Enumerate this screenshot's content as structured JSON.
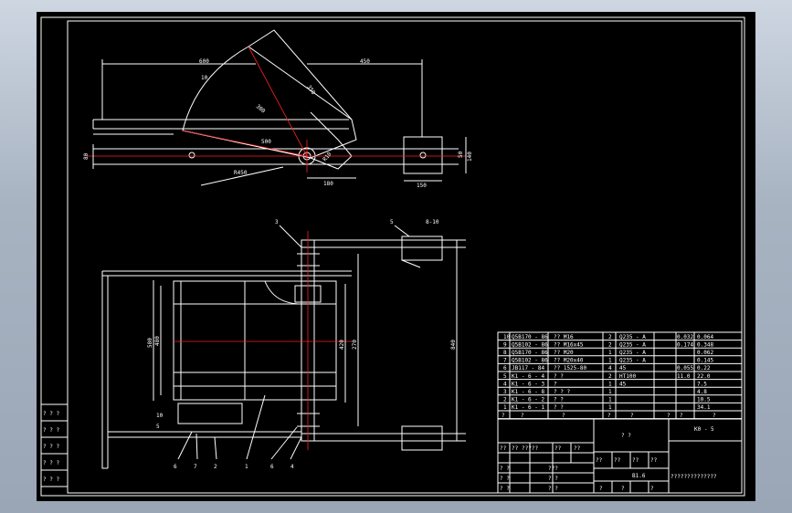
{
  "dims": {
    "d600": "600",
    "d450": "450",
    "d300": "300",
    "d350": "350",
    "d10": "10",
    "d500": "500",
    "d80": "80",
    "d140": "140",
    "d50": "50",
    "dR450": "R450",
    "dR10": "R10",
    "d180": "180",
    "d150": "150",
    "d8_10": "8-10",
    "d580": "580",
    "d480": "480",
    "d420": "420",
    "d270": "270",
    "d840": "840",
    "d10b": "10",
    "d5": "5"
  },
  "balloons": {
    "b3": "3",
    "b5": "5",
    "b6": "6",
    "b7": "7",
    "b2": "2",
    "b1": "1",
    "b6b": "6",
    "b4": "4"
  },
  "bom": [
    [
      "10",
      "Q5B170 - 86",
      "?? M16",
      "2",
      "Q235 - A",
      "0.032",
      "0.064"
    ],
    [
      "9",
      "Q5B102 - 86",
      "?? M16x45",
      "2",
      "Q235 - A",
      "0.174",
      "0.348"
    ],
    [
      "8",
      "Q5B170 - 86",
      "?? M20",
      "1",
      "Q235 - A",
      "",
      "0.062"
    ],
    [
      "7",
      "Q5B102 - 86",
      "?? M20x40",
      "1",
      "Q235 - A",
      "",
      "0.145"
    ],
    [
      "6",
      "JB117 - 84",
      "?? 1525-80",
      "4",
      "45",
      "0.055",
      "0.22"
    ],
    [
      "5",
      "K1 - 6 - 4",
      "? ?",
      "2",
      "HT100",
      "11.0",
      "22.0"
    ],
    [
      "4",
      "K1 - 6 - 3",
      "?",
      "1",
      "45",
      "",
      "7.5"
    ],
    [
      "3",
      "K1 - 6 - 8",
      "? ? ?",
      "1",
      "",
      "",
      "4.8"
    ],
    [
      "2",
      "K1 - 6 - 2",
      "? ?",
      "1",
      "",
      "",
      "10.5"
    ],
    [
      "1",
      "K1 - 6 - 1",
      "? ?",
      "1",
      "",
      "",
      "34.1"
    ]
  ],
  "bom_header": [
    "?",
    "?",
    "?",
    "?",
    "?",
    "?",
    "?",
    "?"
  ],
  "title": {
    "code": "K0 - 5",
    "name": "? ?",
    "scale": "B1.6",
    "company": "??????????????",
    "r1a": "??",
    "r1b": "??",
    "r1c": "?????",
    "r1d": "??",
    "r1e": "??",
    "r2a": "??",
    "r2b": "??",
    "r2c": "??",
    "r2d": "??",
    "r3a": "? ?",
    "r3b": "???",
    "r4a": "? ?",
    "r4b": "? ?",
    "r5a": "? ?",
    "r5b": "? ?",
    "r5c": "?",
    "r5d": "?",
    "r5e": "?"
  },
  "side_table": [
    "? ? ?",
    "? ? ?",
    "? ? ?",
    "? ? ?",
    "? ? ?"
  ]
}
